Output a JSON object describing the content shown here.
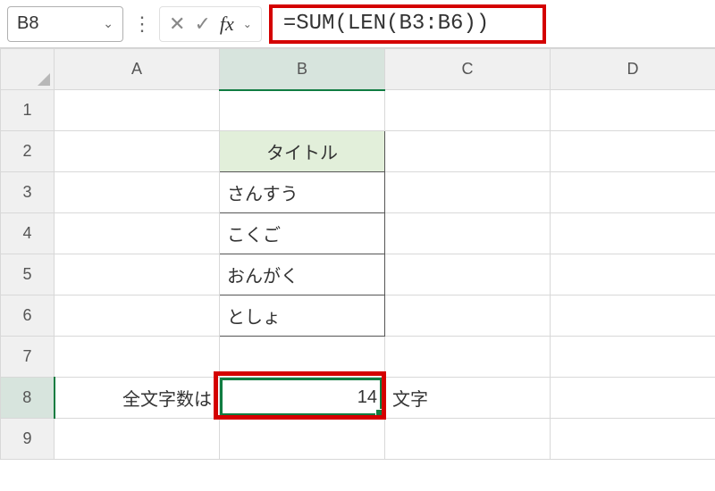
{
  "namebox": {
    "value": "B8"
  },
  "formula_bar": {
    "formula": "=SUM(LEN(B3:B6))"
  },
  "columns": [
    "A",
    "B",
    "C",
    "D"
  ],
  "rows": [
    "1",
    "2",
    "3",
    "4",
    "5",
    "6",
    "7",
    "8",
    "9"
  ],
  "cells": {
    "B2": "タイトル",
    "B3": "さんすう",
    "B4": "こくご",
    "B5": "おんがく",
    "B6": "としょ",
    "A8": "全文字数は",
    "B8": "14",
    "C8": "文字"
  },
  "icons": {
    "cancel": "✕",
    "confirm": "✓",
    "fx": "fx",
    "chevron": "⌄",
    "vdots": "⋮"
  }
}
